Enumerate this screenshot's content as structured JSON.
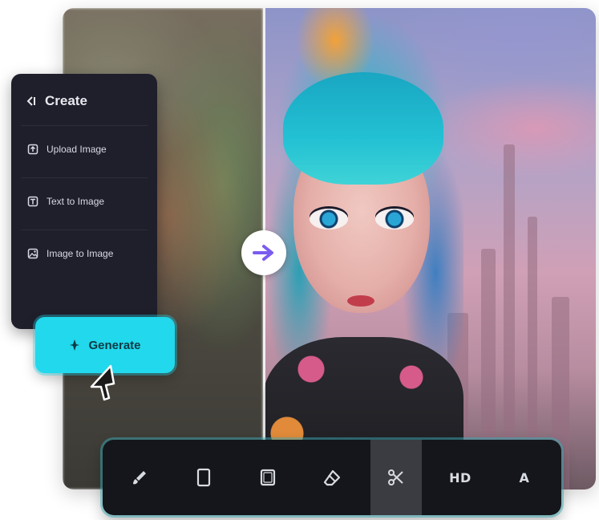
{
  "panel": {
    "title": "Create",
    "items": [
      {
        "label": "Upload Image",
        "icon": "upload-icon"
      },
      {
        "label": "Text to Image",
        "icon": "text-icon"
      },
      {
        "label": "Image to Image",
        "icon": "image-icon"
      }
    ]
  },
  "generate": {
    "label": "Generate",
    "icon": "sparkle-icon",
    "color": "#22d8ec"
  },
  "compare": {
    "handle_icon": "arrow-right-icon",
    "accent": "#7b5cf0"
  },
  "toolbar": {
    "tools": [
      {
        "name": "brush-tool",
        "icon": "brush-icon",
        "label": ""
      },
      {
        "name": "crop-portrait-tool",
        "icon": "portrait-frame-icon",
        "label": ""
      },
      {
        "name": "crop-square-tool",
        "icon": "square-frame-icon",
        "label": ""
      },
      {
        "name": "eraser-tool",
        "icon": "eraser-icon",
        "label": ""
      },
      {
        "name": "remove-tool",
        "icon": "scissors-icon",
        "label": "",
        "active": true
      },
      {
        "name": "hd-upscale-tool",
        "icon": "",
        "label": "HD"
      },
      {
        "name": "text-tool",
        "icon": "",
        "label": "A"
      }
    ]
  }
}
